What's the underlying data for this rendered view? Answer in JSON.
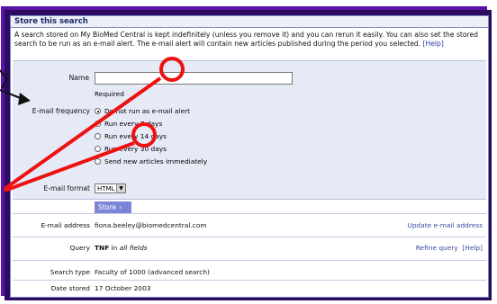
{
  "panel": {
    "title": "Store this search",
    "intro_text": "A search stored on My BioMed Central is kept indefinitely (unless you remove it) and you can rerun it easily. You can also set the stored search to be run as an e-mail alert. The e-mail alert will contain new articles published during the period you selected.",
    "help_link": "[Help]"
  },
  "form": {
    "name_label": "Name",
    "name_value": "",
    "required_text": "Required",
    "email_frequency_label": "E-mail frequency",
    "frequency_options": [
      "Do not run as e-mail alert",
      "Run every 7 days",
      "Run every 14 days",
      "Run every 30 days",
      "Send new articles immediately"
    ],
    "email_format_label": "E-mail format",
    "email_format_value": "HTML",
    "store_label": "Store"
  },
  "details": {
    "email_label": "E-mail address",
    "email_value": "fiona.beeley@biomedcentral.com",
    "update_email": "Update e-mail address",
    "query_label": "Query",
    "query_term": "TNF",
    "query_in": " in ",
    "query_fields": "all fields",
    "refine_query": "Refine query",
    "query_help": "[Help]",
    "search_type_label": "Search type",
    "search_type_value": "Faculty of 1000  (advanced search)",
    "date_stored_label": "Date stored",
    "date_stored_value": "17 October 2003"
  },
  "colors": {
    "frame": "#5a13a8",
    "annotation": "#ee1111",
    "store_button": "#7c86d6"
  }
}
